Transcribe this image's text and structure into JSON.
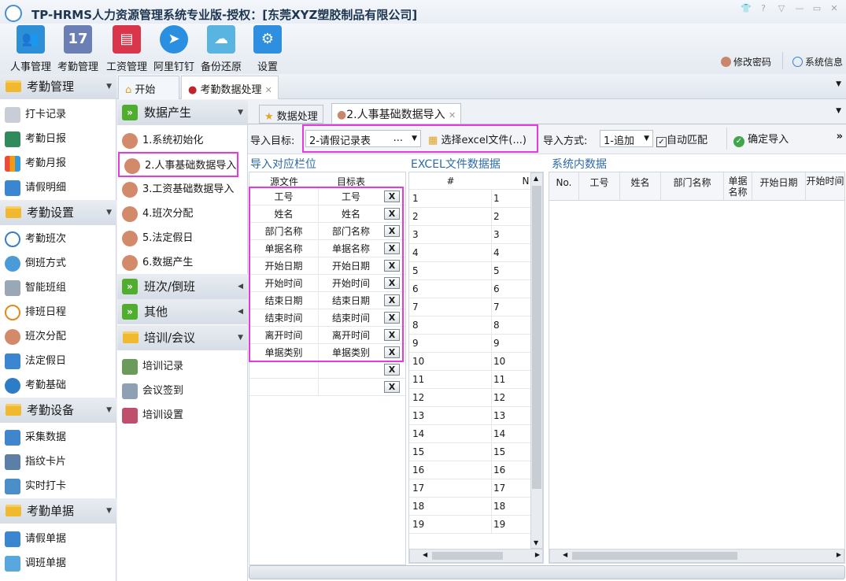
{
  "window": {
    "title": "TP-HRMS人力资源管理系统专业版-授权：[东莞XYZ塑胶制品有限公司]"
  },
  "ribbon": {
    "buttons": [
      {
        "label": "人事管理",
        "icon": "people-icon",
        "color": "#2d8fd8"
      },
      {
        "label": "考勤管理",
        "icon": "calendar-icon",
        "color": "#6b7fb5",
        "glyph": "17"
      },
      {
        "label": "工资管理",
        "icon": "payroll-icon",
        "color": "#d9364c"
      },
      {
        "label": "阿里钉钉",
        "icon": "dingtalk-icon",
        "color": "#2a8fe0"
      },
      {
        "label": "备份还原",
        "icon": "cloud-icon",
        "color": "#5ab4e2"
      },
      {
        "label": "设置",
        "icon": "gear-icon",
        "color": "#2e8fe0"
      }
    ],
    "change_password": "修改密码",
    "system_info": "系统信息"
  },
  "top_tabs": {
    "start": "开始",
    "attendance_import": "考勤数据处理"
  },
  "sidebar": {
    "sections": [
      {
        "label": "考勤管理",
        "items": [
          "打卡记录",
          "考勤日报",
          "考勤月报",
          "请假明细"
        ]
      },
      {
        "label": "考勤设置",
        "items": [
          "考勤班次",
          "倒班方式",
          "智能班组",
          "排班日程",
          "班次分配",
          "法定假日",
          "考勤基础"
        ]
      },
      {
        "label": "考勤设备",
        "items": [
          "采集数据",
          "指纹卡片",
          "实时打卡"
        ]
      },
      {
        "label": "考勤单据",
        "items": [
          "请假单据",
          "调班单据"
        ]
      }
    ]
  },
  "sub_sidebar": {
    "data_section": "数据产生",
    "data_items": [
      "1.系统初始化",
      "2.人事基础数据导入",
      "3.工资基础数据导入",
      "4.班次分配",
      "5.法定假日",
      "6.数据产生"
    ],
    "shift_section": "班次/倒班",
    "other_section": "其他",
    "training_section": "培训/会议",
    "training_items": [
      "培训记录",
      "会议签到",
      "培训设置"
    ]
  },
  "content_tabs": {
    "data_process": "数据处理",
    "import_tab": "2.人事基础数据导入"
  },
  "toolbar": {
    "target_label": "导入目标:",
    "target_value": "2-请假记录表",
    "target_ellipsis": "...",
    "select_file": "选择excel文件(...)",
    "mode_label": "导入方式:",
    "mode_value": "1-追加",
    "auto_match": "自动匹配",
    "confirm": "确定导入",
    "more": "»"
  },
  "mapping": {
    "title": "导入对应栏位",
    "col_source": "源文件",
    "col_target": "目标表",
    "x_label": "X",
    "rows": [
      [
        "工号",
        "工号"
      ],
      [
        "姓名",
        "姓名"
      ],
      [
        "部门名称",
        "部门名称"
      ],
      [
        "单据名称",
        "单据名称"
      ],
      [
        "开始日期",
        "开始日期"
      ],
      [
        "开始时间",
        "开始时间"
      ],
      [
        "结束日期",
        "结束日期"
      ],
      [
        "结束时间",
        "结束时间"
      ],
      [
        "离开时间",
        "离开时间"
      ],
      [
        "单据类别",
        "单据类别"
      ],
      [
        "",
        ""
      ],
      [
        "",
        ""
      ]
    ]
  },
  "excel": {
    "title": "EXCEL文件数据据",
    "col_hash": "#",
    "col_n": "N",
    "rows": [
      [
        "1",
        "1"
      ],
      [
        "2",
        "2"
      ],
      [
        "3",
        "3"
      ],
      [
        "4",
        "4"
      ],
      [
        "5",
        "5"
      ],
      [
        "6",
        "6"
      ],
      [
        "7",
        "7"
      ],
      [
        "8",
        "8"
      ],
      [
        "9",
        "9"
      ],
      [
        "10",
        "10"
      ],
      [
        "11",
        "11"
      ],
      [
        "12",
        "12"
      ],
      [
        "13",
        "13"
      ],
      [
        "14",
        "14"
      ],
      [
        "15",
        "15"
      ],
      [
        "16",
        "16"
      ],
      [
        "17",
        "17"
      ],
      [
        "18",
        "18"
      ],
      [
        "19",
        "19"
      ]
    ]
  },
  "system": {
    "title": "系统内数据",
    "cols": [
      "No.",
      "工号",
      "姓名",
      "部门名称",
      "单据名称",
      "开始日期",
      "开始时间"
    ]
  }
}
